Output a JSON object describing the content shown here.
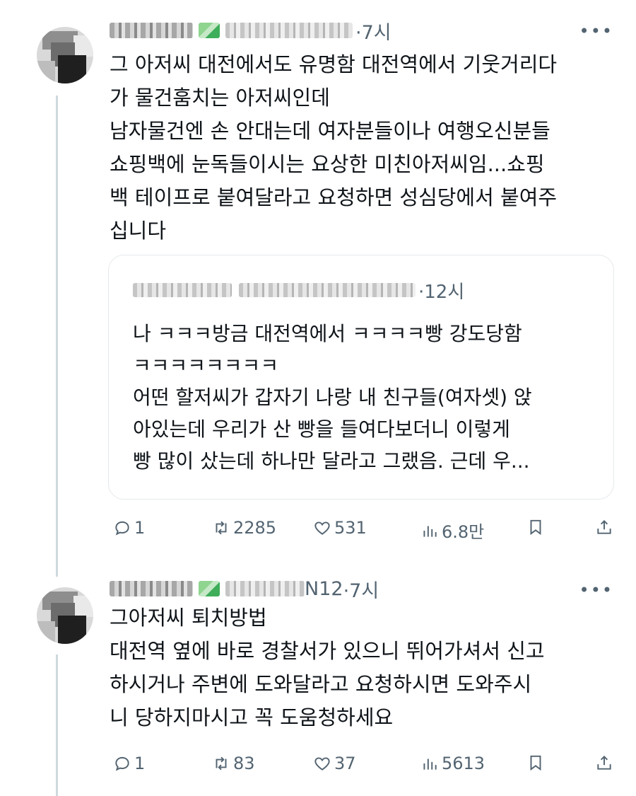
{
  "tweet1": {
    "time": "7시",
    "text": "그 아저씨 대전에서도 유명함 대전역에서 기웃거리다\n가 물건훔치는 아저씨인데\n남자물건엔 손 안대는데 여자분들이나 여행오신분들\n쇼핑백에 눈독들이시는 요상한 미친아저씨임...쇼핑\n백 테이프로 붙여달라고 요청하면 성심당에서 붙여주\n십니다",
    "quote": {
      "time": "12시",
      "text": "나 ㅋㅋㅋ방금 대전역에서 ㅋㅋㅋㅋ빵 강도당함\nㅋㅋㅋㅋㅋㅋㅋㅋ\n어떤 할저씨가 갑자기 나랑 내 친구들(여자셋) 앉\n아있는데 우리가 산 빵을 들여다보더니 이렇게\n빵 많이 샀는데 하나만 달라고 그랬음. 근데 우..."
    },
    "actions": {
      "replies": "1",
      "reposts": "2285",
      "likes": "531",
      "views": "6.8만"
    }
  },
  "tweet2": {
    "handle_suffix": "N12",
    "time": "7시",
    "text": "그아저씨 퇴치방법\n대전역 옆에 바로 경찰서가 있으니 뛰어가셔서 신고\n하시거나 주변에 도와달라고 요청하시면 도와주시\n니 당하지마시고 꼭 도움청하세요",
    "actions": {
      "replies": "1",
      "reposts": "83",
      "likes": "37",
      "views": "5613"
    }
  },
  "more_label": "•••"
}
